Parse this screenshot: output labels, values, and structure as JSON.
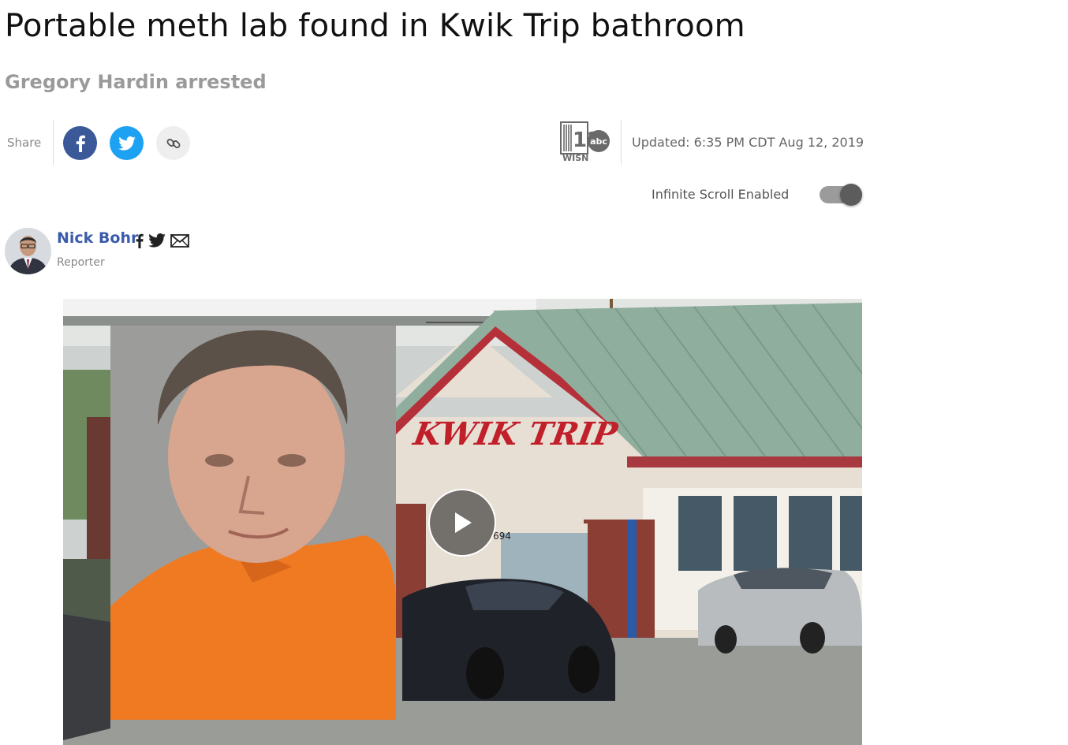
{
  "article": {
    "headline": "Portable meth lab found in Kwik Trip bathroom",
    "subheadline": "Gregory Hardin arrested"
  },
  "share": {
    "label": "Share",
    "buttons": [
      {
        "name": "facebook",
        "icon": "facebook-icon",
        "color": "#3b5998"
      },
      {
        "name": "twitter",
        "icon": "twitter-icon",
        "color": "#1da1f2"
      },
      {
        "name": "copy-link",
        "icon": "link-icon",
        "color": "#eeeeee"
      }
    ]
  },
  "station": {
    "logo_number": "12",
    "logo_network": "abc",
    "logo_call": "WISN"
  },
  "updated": "Updated: 6:35 PM CDT Aug 12, 2019",
  "infinite_scroll": {
    "label": "Infinite Scroll Enabled",
    "enabled": true
  },
  "author": {
    "name": "Nick Bohr",
    "role": "Reporter",
    "social_icons": [
      "facebook-icon",
      "twitter-icon",
      "email-icon"
    ]
  },
  "media": {
    "type": "video",
    "store_sign": "KWIK TRIP",
    "address_number": "694",
    "play_icon": "play-icon"
  },
  "colors": {
    "author_link": "#3a5bab",
    "facebook": "#3b5998",
    "twitter": "#1da1f2",
    "mugshot_shirt": "#f07a22"
  }
}
